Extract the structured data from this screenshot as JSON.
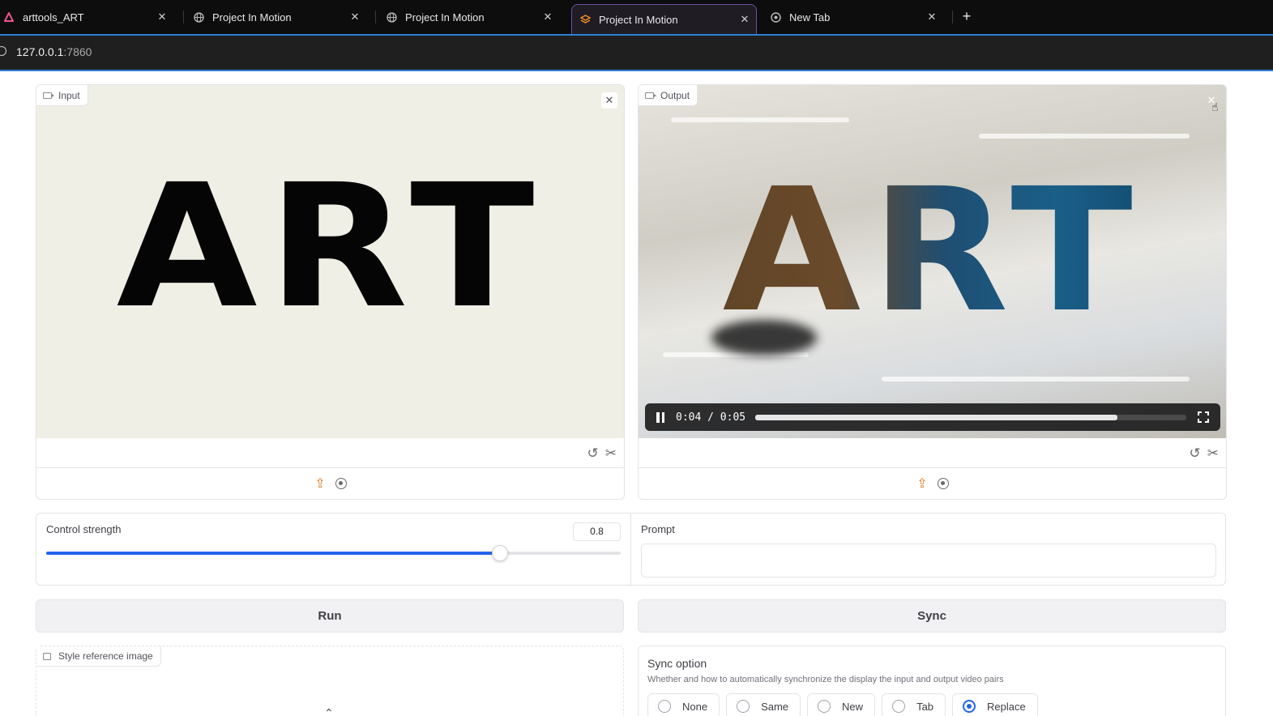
{
  "browser": {
    "tabs": [
      {
        "title": "arttools_ART",
        "favicon": "arttools-logo-icon",
        "active": false
      },
      {
        "title": "Project In Motion",
        "favicon": "globe-icon",
        "active": false
      },
      {
        "title": "Project In Motion",
        "favicon": "globe-icon",
        "active": false
      },
      {
        "title": "Project In Motion",
        "favicon": "gradio-logo-icon",
        "active": true
      },
      {
        "title": "New Tab",
        "favicon": "chrome-icon",
        "active": false
      }
    ],
    "new_tab_icon": "plus-icon",
    "url_host": "127.0.0.1",
    "url_port": ":7860",
    "accent_color": "#2d7fd2"
  },
  "input_panel": {
    "label": "Input",
    "video_text": "ART"
  },
  "output_panel": {
    "label": "Output",
    "video_text": "ART",
    "time_display": "0:04 / 0:05",
    "progress_fraction": 0.84
  },
  "controls": {
    "strength_label": "Control strength",
    "strength_value": "0.8",
    "strength_fraction": 0.79,
    "prompt_label": "Prompt",
    "prompt_value": "",
    "slider_color": "#2563eb"
  },
  "buttons": {
    "run_label": "Run",
    "sync_label": "Sync"
  },
  "style_reference": {
    "label": "Style reference image"
  },
  "sync_option": {
    "title": "Sync option",
    "description": "Whether and how to automatically synchronize the display the input and output video pairs",
    "options": [
      "None",
      "Same",
      "New",
      "Tab",
      "Replace"
    ],
    "selected": "Replace"
  }
}
